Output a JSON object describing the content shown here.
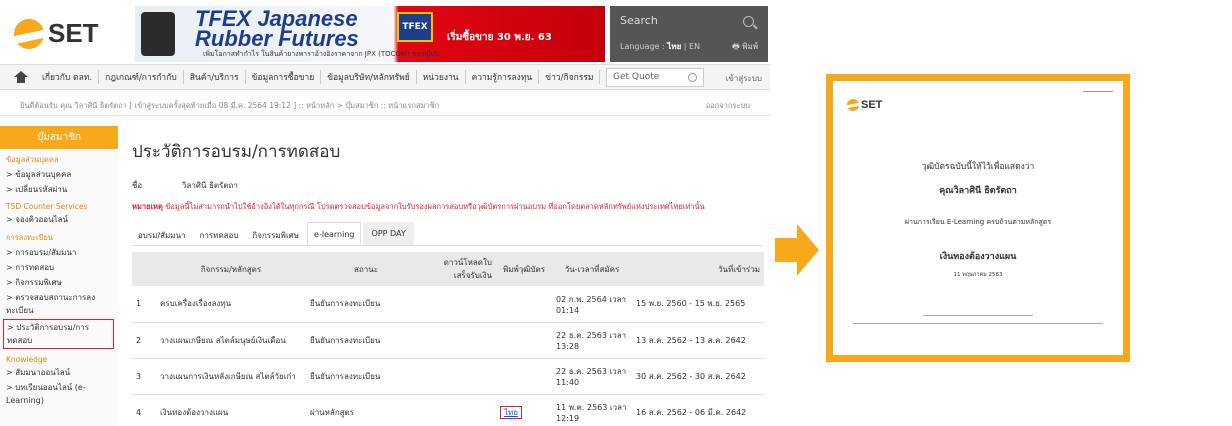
{
  "logo": {
    "text": "SET"
  },
  "banner": {
    "title_line1": "TFEX Japanese",
    "title_line2": "Rubber Futures",
    "subtitle": "เพิ่มโอกาสทำกำไร ในสินค้ายางพาราอ้างอิงราคาจาก JPX (TOCOM) ของญี่ปุ่น",
    "badge": "TFEX",
    "promo": "เริ่มซื้อขาย 30 พ.ย. 63"
  },
  "search": {
    "label": "Search",
    "language_prefix": "Language :",
    "lang_th": "ไทย",
    "lang_en": "EN",
    "print": "พิมพ์"
  },
  "nav": {
    "items": [
      "เกี่ยวกับ ตลท.",
      "กฎเกณฑ์/การกำกับ",
      "สินค้า/บริการ",
      "ข้อมูลการซื้อขาย",
      "ข้อมูลบริษัท/หลักทรัพย์",
      "หน่วยงาน",
      "ความรู้การลงทุน",
      "ข่าว/กิจกรรม"
    ],
    "get_quote": "Get Quote",
    "login": "เข้าสู่ระบบ"
  },
  "welcome": {
    "text": "ยินดีต้อนรับ คุณ วิลาศินี ธิตรัตถา",
    "last_login": "[ เข้าสู่ระบบครั้งสุดท้ายเมื่อ 08 มี.ค. 2564 19:12 ] :: หน้าหลัก > บุ๊มสมาชิก :: หน้าแรกสมาชิก",
    "logout": "ออกจากระบบ"
  },
  "sidebar": {
    "header": "บุ๊มสมาชิก",
    "sections": [
      {
        "title": "ข้อมูลส่วนบุคคล",
        "items": [
          "> ข้อมูลส่วนบุคคล",
          "> เปลี่ยนรหัสผ่าน"
        ]
      },
      {
        "title": "TSD Counter Services",
        "items": [
          "> จองคิวออนไลน์"
        ]
      },
      {
        "title": "การลงทะเบียน",
        "items": [
          "> การอบรม/สัมมนา",
          "> การทดสอบ",
          "> กิจกรรมพิเศษ",
          "> ตรวจสอบสถานะการลงทะเบียน",
          "> ประวัติการอบรม/การทดสอบ"
        ]
      },
      {
        "title": "Knowledge",
        "items": [
          "> สัมมนาออนไลน์",
          "> บทเรียนออนไลน์ (e-Learning)"
        ]
      }
    ]
  },
  "main": {
    "title": "ประวัติการอบรม/การทดสอบ",
    "name_label": "ชื่อ",
    "name_value": "วิลาศินี ธิตรัตถา",
    "note_bold": "หมายเหตุ",
    "note": "ข้อมูลนี้ไม่สามารถนำไปใช้อ้างอิงได้ในทุกกรณี โปรดตรวจสอบข้อมูลจากใบรับรองผลการสอบหรือวุฒิบัตรการผ่านอบรม ที่ออกโดยตลาดหลักทรัพย์แห่งประเทศไทยเท่านั้น",
    "tabs": [
      "อบรม/สัมมนา",
      "การทดสอบ",
      "กิจกรรมพิเศษ",
      "e-learning",
      "OPP DAY"
    ],
    "table": {
      "headers": [
        "",
        "กิจกรรม/หลักสูตร",
        "สถานะ",
        "ดาวน์โหลดใบเสร็จรับเงิน",
        "พิมพ์วุฒิบัตร",
        "วัน-เวลาที่สมัคร",
        "วันที่เข้าร่วม"
      ],
      "rows": [
        {
          "no": "1",
          "course": "ครบเครื่องเรื่องลงทุน",
          "status": "ยืนยันการลงทะเบียน",
          "receipt": "",
          "cert": "",
          "applied": "02 ก.พ. 2564 เวลา 01:14",
          "dates": "15 พ.ย. 2560 - 15 พ.ย. 2565"
        },
        {
          "no": "2",
          "course": "วางแผนเกษียณ สไตล์มนุษย์เงินเดือน",
          "status": "ยืนยันการลงทะเบียน",
          "receipt": "",
          "cert": "",
          "applied": "22 ธ.ค. 2563 เวลา 13:28",
          "dates": "13 ส.ค. 2562 - 13 ส.ค. 2642"
        },
        {
          "no": "3",
          "course": "วางแผนการเงินหลังเกษียณ สไตล์วัยเก๋า",
          "status": "ยืนยันการลงทะเบียน",
          "receipt": "",
          "cert": "",
          "applied": "22 ธ.ค. 2563 เวลา 11:40",
          "dates": "30 ส.ค. 2562 - 30 ส.ค. 2642"
        },
        {
          "no": "4",
          "course": "เงินทองต้องวางแผน",
          "status": "ผ่านหลักสูตร",
          "receipt": "",
          "cert": "ไทย",
          "applied": "11 พ.ค. 2563 เวลา 12:19",
          "dates": "16 ส.ค. 2562 - 06 มี.ค. 2642"
        }
      ]
    }
  },
  "certificate": {
    "logo": "SET",
    "line1": "วุฒิบัตรฉบับนี้ให้ไว้เพื่อแสดงว่า",
    "name": "คุณวิลาศินี ธิตรัตถา",
    "line3": "ผ่านการเรียน E-Learning ครบถ้วนตามหลักสูตร",
    "course": "เงินทองต้องวางแผน",
    "date": "11 พฤษภาคม 2563"
  },
  "colors": {
    "accent": "#f7a81b",
    "alert": "#d9232d",
    "link": "#1155cc"
  }
}
